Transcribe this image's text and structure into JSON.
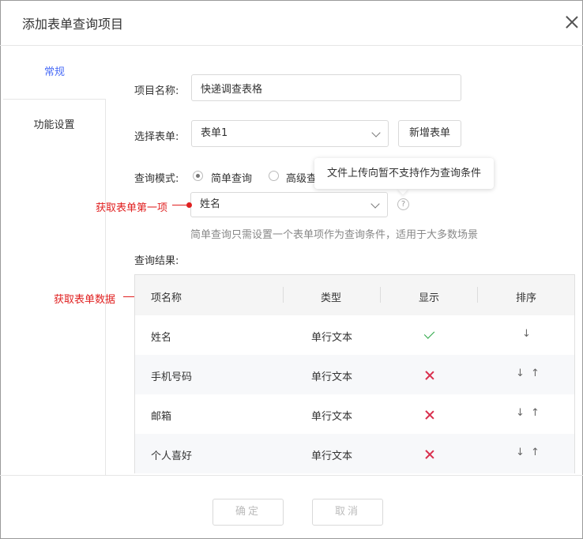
{
  "dialog": {
    "title": "添加表单查询项目"
  },
  "sidebar": {
    "tabs": [
      {
        "label": "常规"
      },
      {
        "label": "功能设置"
      }
    ]
  },
  "form": {
    "project_name_label": "项目名称:",
    "project_name_value": "快递调查表格",
    "select_form_label": "选择表单:",
    "select_form_value": "表单1",
    "new_form_button": "新增表单",
    "query_mode_label": "查询模式:",
    "mode_simple": "简单查询",
    "mode_advanced": "高级查",
    "field_select_value": "姓名",
    "help_icon": "?",
    "hint": "简单查询只需设置一个表单项作为查询条件，适用于大多数场景",
    "result_label": "查询结果:"
  },
  "tooltip": {
    "text": "文件上传向暂不支持作为查询条件"
  },
  "annotations": {
    "first_item": "获取表单第一项",
    "form_data": "获取表单数据"
  },
  "table": {
    "headers": [
      "项名称",
      "类型",
      "显示",
      "排序"
    ],
    "rows": [
      {
        "name": "姓名",
        "type": "单行文本",
        "display": "check",
        "sort": "↓"
      },
      {
        "name": "手机号码",
        "type": "单行文本",
        "display": "cross",
        "sort": "↓ ↑"
      },
      {
        "name": "邮箱",
        "type": "单行文本",
        "display": "cross",
        "sort": "↓ ↑"
      },
      {
        "name": "个人喜好",
        "type": "单行文本",
        "display": "cross",
        "sort": "↓ ↑"
      }
    ]
  },
  "footer": {
    "confirm": "确定",
    "cancel": "取消"
  },
  "colors": {
    "accent": "#4a6cf7",
    "annotation": "#e02020",
    "check": "#2aa745",
    "cross": "#d9304e"
  }
}
